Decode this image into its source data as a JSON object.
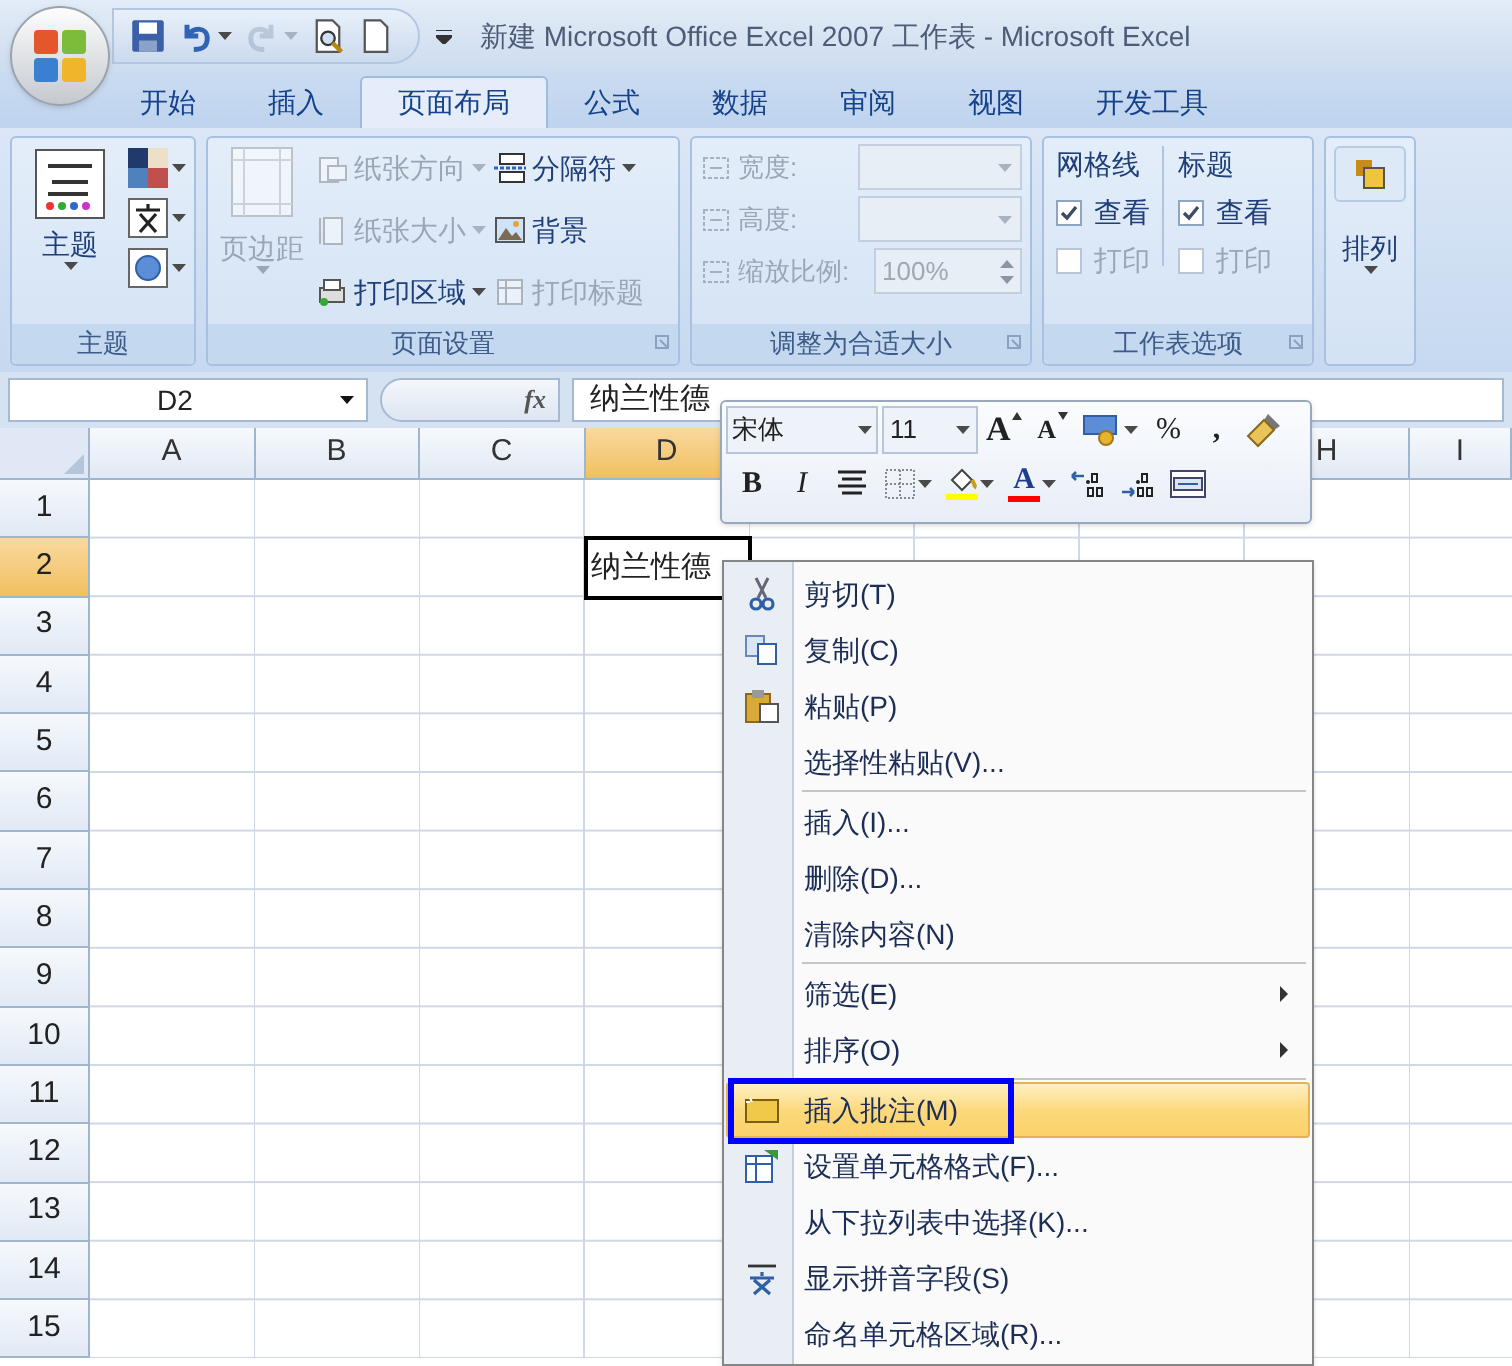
{
  "window": {
    "title": "新建 Microsoft Office Excel 2007 工作表 - Microsoft Excel"
  },
  "quick_access": [
    {
      "kind": "save",
      "disabled": false
    },
    {
      "kind": "undo",
      "disabled": false
    },
    {
      "kind": "redo",
      "disabled": true
    },
    {
      "kind": "print_preview",
      "disabled": false
    },
    {
      "kind": "new",
      "disabled": false
    }
  ],
  "tabs": [
    {
      "label": "开始",
      "selected": false
    },
    {
      "label": "插入",
      "selected": false
    },
    {
      "label": "页面布局",
      "selected": true
    },
    {
      "label": "公式",
      "selected": false
    },
    {
      "label": "数据",
      "selected": false
    },
    {
      "label": "审阅",
      "selected": false
    },
    {
      "label": "视图",
      "selected": false
    },
    {
      "label": "开发工具",
      "selected": false
    }
  ],
  "ribbon": {
    "theme": {
      "label": "主题",
      "button": "主题"
    },
    "page_setup": {
      "label": "页面设置",
      "big": {
        "label": "页边距",
        "disabled": true
      },
      "items": [
        {
          "kind": "orientation",
          "label": "纸张方向",
          "disabled": true,
          "dropdown": true
        },
        {
          "kind": "size",
          "label": "纸张大小",
          "disabled": true,
          "dropdown": true
        },
        {
          "kind": "print_area",
          "label": "打印区域",
          "disabled": false,
          "dropdown": true
        },
        {
          "kind": "breaks",
          "label": "分隔符",
          "disabled": false,
          "dropdown": true
        },
        {
          "kind": "background",
          "label": "背景",
          "disabled": false,
          "dropdown": false
        },
        {
          "kind": "print_titles",
          "label": "打印标题",
          "disabled": true,
          "dropdown": false
        }
      ]
    },
    "scale_to_fit": {
      "label": "调整为合适大小",
      "fields": [
        {
          "kind": "dropdown",
          "label": "宽度:",
          "disabled": true
        },
        {
          "kind": "dropdown",
          "label": "高度:",
          "disabled": true
        },
        {
          "kind": "spinner",
          "label": "缩放比例:",
          "value": "100%",
          "disabled": true
        }
      ]
    },
    "sheet_options": {
      "label": "工作表选项",
      "columns": [
        {
          "title": "网格线",
          "options": [
            {
              "label": "查看",
              "checked": true,
              "disabled": false
            },
            {
              "label": "打印",
              "checked": false,
              "disabled": true
            }
          ]
        },
        {
          "title": "标题",
          "options": [
            {
              "label": "查看",
              "checked": true,
              "disabled": false
            },
            {
              "label": "打印",
              "checked": false,
              "disabled": true
            }
          ]
        }
      ]
    },
    "arrange": {
      "label": "排列"
    }
  },
  "formula_bar": {
    "name_box": "D2",
    "function_label": "fx",
    "content": "纳兰性德"
  },
  "sheet": {
    "columns": [
      {
        "label": "A",
        "selected": false
      },
      {
        "label": "B",
        "selected": false
      },
      {
        "label": "C",
        "selected": false
      },
      {
        "label": "D",
        "selected": true
      },
      {
        "label": "H",
        "selected": false
      },
      {
        "label": "I",
        "selected": false
      }
    ],
    "rows": [
      {
        "label": "1",
        "selected": false
      },
      {
        "label": "2",
        "selected": true,
        "cells": [
          null,
          null,
          null,
          "纳兰性德"
        ]
      },
      {
        "label": "3",
        "selected": false
      },
      {
        "label": "4",
        "selected": false
      },
      {
        "label": "5",
        "selected": false
      },
      {
        "label": "6",
        "selected": false
      },
      {
        "label": "7",
        "selected": false
      },
      {
        "label": "8",
        "selected": false
      },
      {
        "label": "9",
        "selected": false
      },
      {
        "label": "10",
        "selected": false
      },
      {
        "label": "11",
        "selected": false
      },
      {
        "label": "12",
        "selected": false
      },
      {
        "label": "13",
        "selected": false
      },
      {
        "label": "14",
        "selected": false
      },
      {
        "label": "15",
        "selected": false
      }
    ]
  },
  "mini_toolbar": {
    "font": "宋体",
    "size": "11",
    "row1": [
      {
        "kind": "grow_font",
        "glyph": "A"
      },
      {
        "kind": "shrink_font",
        "glyph": "A"
      },
      {
        "kind": "accounting"
      },
      {
        "kind": "percent",
        "glyph": "%"
      },
      {
        "kind": "comma",
        "glyph": ","
      },
      {
        "kind": "format_painter"
      }
    ],
    "row2": [
      {
        "kind": "bold",
        "glyph": "B"
      },
      {
        "kind": "italic",
        "glyph": "I"
      },
      {
        "kind": "center"
      },
      {
        "kind": "borders"
      },
      {
        "kind": "fill_color",
        "color": "#ffff00"
      },
      {
        "kind": "font_color",
        "glyph": "A",
        "color": "#ff0000"
      },
      {
        "kind": "increase_decimal"
      },
      {
        "kind": "decrease_decimal"
      },
      {
        "kind": "merge"
      }
    ]
  },
  "context_menu": [
    {
      "kind": "cut",
      "label": "剪切(T)",
      "selected": false,
      "submenu": false,
      "annotated": false
    },
    {
      "kind": "copy",
      "label": "复制(C)",
      "selected": false,
      "submenu": false,
      "annotated": false
    },
    {
      "kind": "paste",
      "label": "粘贴(P)",
      "selected": false,
      "submenu": false,
      "annotated": false
    },
    {
      "kind": "plain",
      "label": "选择性粘贴(V)...",
      "selected": false,
      "submenu": false,
      "annotated": false
    },
    {
      "kind": "separator"
    },
    {
      "kind": "plain",
      "label": "插入(I)...",
      "selected": false,
      "submenu": false,
      "annotated": false
    },
    {
      "kind": "plain",
      "label": "删除(D)...",
      "selected": false,
      "submenu": false,
      "annotated": false
    },
    {
      "kind": "plain",
      "label": "清除内容(N)",
      "selected": false,
      "submenu": false,
      "annotated": false
    },
    {
      "kind": "separator"
    },
    {
      "kind": "plain",
      "label": "筛选(E)",
      "selected": false,
      "submenu": true,
      "annotated": false
    },
    {
      "kind": "plain",
      "label": "排序(O)",
      "selected": false,
      "submenu": true,
      "annotated": false
    },
    {
      "kind": "separator"
    },
    {
      "kind": "comment",
      "label": "插入批注(M)",
      "selected": true,
      "submenu": false,
      "annotated": true
    },
    {
      "kind": "format",
      "label": "设置单元格格式(F)...",
      "selected": false,
      "submenu": false,
      "annotated": false
    },
    {
      "kind": "plain",
      "label": "从下拉列表中选择(K)...",
      "selected": false,
      "submenu": false,
      "annotated": false
    },
    {
      "kind": "pinyin",
      "label": "显示拼音字段(S)",
      "selected": false,
      "submenu": false,
      "annotated": false
    },
    {
      "kind": "plain",
      "label": "命名单元格区域(R)...",
      "selected": false,
      "submenu": false,
      "annotated": false
    }
  ]
}
